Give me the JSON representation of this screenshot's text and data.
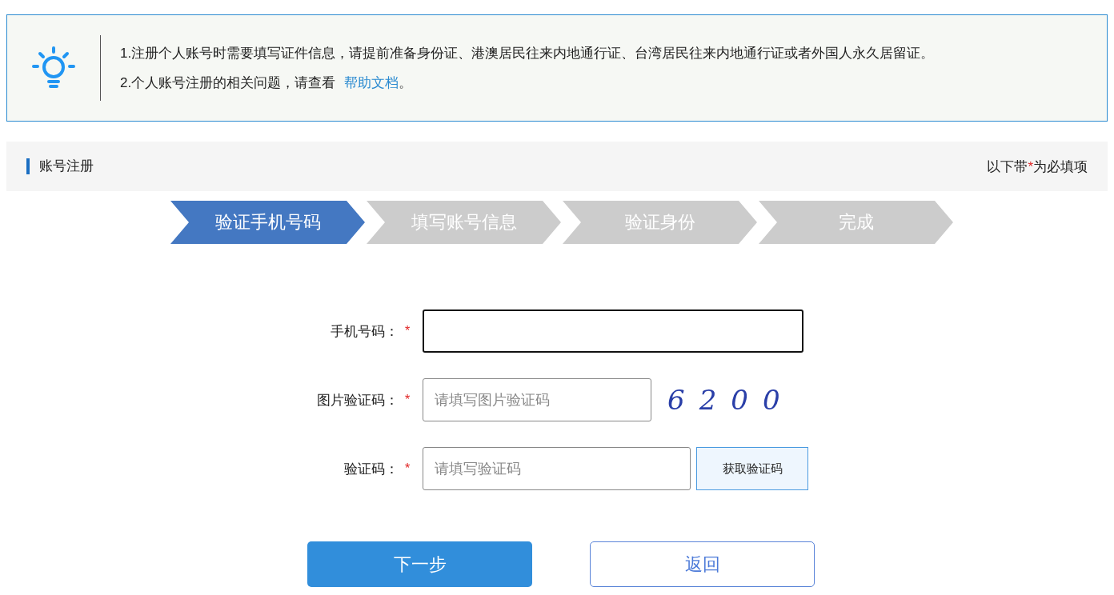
{
  "notice": {
    "lines": [
      {
        "text": "1.注册个人账号时需要填写证件信息，请提前准备身份证、港澳居民往来内地通行证、台湾居民往来内地通行证或者外国人永久居留证。"
      },
      {
        "text": "2.个人账号注册的相关问题，请查看 ",
        "link": "帮助文档",
        "after": "。"
      }
    ]
  },
  "section": {
    "title": "账号注册",
    "required_note": {
      "before": "以下带",
      "mark": "*",
      "after": "为必填项"
    }
  },
  "steps": [
    {
      "label": "验证手机号码",
      "selected": true
    },
    {
      "label": "填写账号信息",
      "selected": false
    },
    {
      "label": "验证身份",
      "selected": false
    },
    {
      "label": "完成",
      "selected": false
    }
  ],
  "form": [
    {
      "kind": "text",
      "label": "手机号码：",
      "required": true,
      "focused": true
    },
    {
      "kind": "captcha",
      "label": "图片验证码：",
      "required": true,
      "focused": false,
      "placeholder": "请填写图片验证码",
      "captcha_text": "6200"
    },
    {
      "kind": "sms",
      "label": "验证码：",
      "required": true,
      "focused": false,
      "placeholder": "请填写验证码",
      "button": "获取验证码"
    }
  ],
  "buttons": [
    {
      "kind": "primary",
      "label": "下一步"
    },
    {
      "kind": "secondary",
      "label": "返回"
    }
  ]
}
